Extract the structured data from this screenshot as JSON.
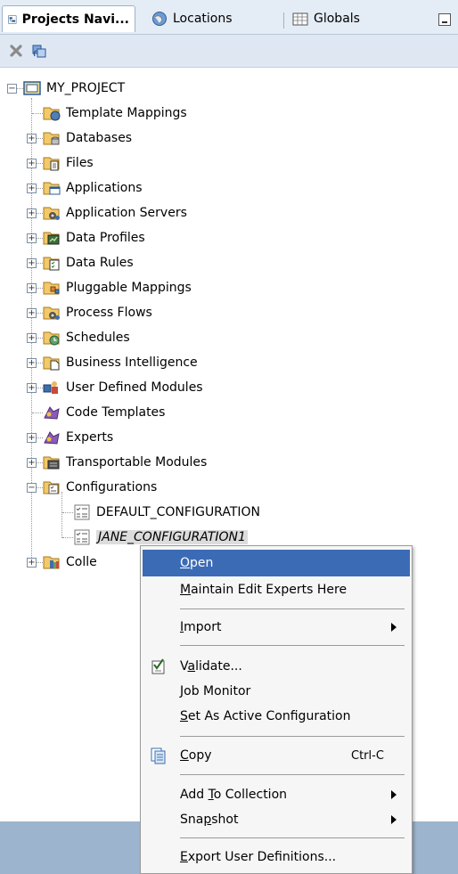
{
  "tabs": [
    {
      "label": "Projects Navi..."
    },
    {
      "label": "Locations"
    },
    {
      "label": "Globals"
    }
  ],
  "toolbar": {
    "icons": [
      "delete-icon",
      "refresh-icon"
    ]
  },
  "tree": {
    "root": "MY_PROJECT",
    "items": [
      "Template Mappings",
      "Databases",
      "Files",
      "Applications",
      "Application Servers",
      "Data Profiles",
      "Data Rules",
      "Pluggable Mappings",
      "Process Flows",
      "Schedules",
      "Business Intelligence",
      "User Defined Modules",
      "Code Templates",
      "Experts",
      "Transportable Modules",
      "Configurations",
      "DEFAULT_CONFIGURATION",
      "JANE_CONFIGURATION1",
      "Colle"
    ]
  },
  "menu": {
    "open": {
      "mn": "O",
      "rest": "pen"
    },
    "maintain": {
      "mn": "M",
      "rest": "aintain Edit Experts Here"
    },
    "import": {
      "mn": "I",
      "rest": "mport"
    },
    "validate": {
      "pre": "V",
      "mn": "a",
      "rest": "lidate..."
    },
    "job_monitor": {
      "mn": "J",
      "rest": "ob Monitor"
    },
    "set_active": {
      "mn": "S",
      "rest": "et As Active Configuration"
    },
    "copy": {
      "mn": "C",
      "rest": "opy",
      "accel": "Ctrl-C"
    },
    "add_collection": {
      "pre": "Add ",
      "mn": "T",
      "rest": "o Collection"
    },
    "snapshot": {
      "pre": "Sna",
      "mn": "p",
      "rest": "shot"
    },
    "export": {
      "mn": "E",
      "rest": "xport User Definitions..."
    }
  },
  "colors": {
    "highlight": "#3c6bb6",
    "tabbar": "#e4ecf5",
    "statusbar": "#9db4cf"
  }
}
